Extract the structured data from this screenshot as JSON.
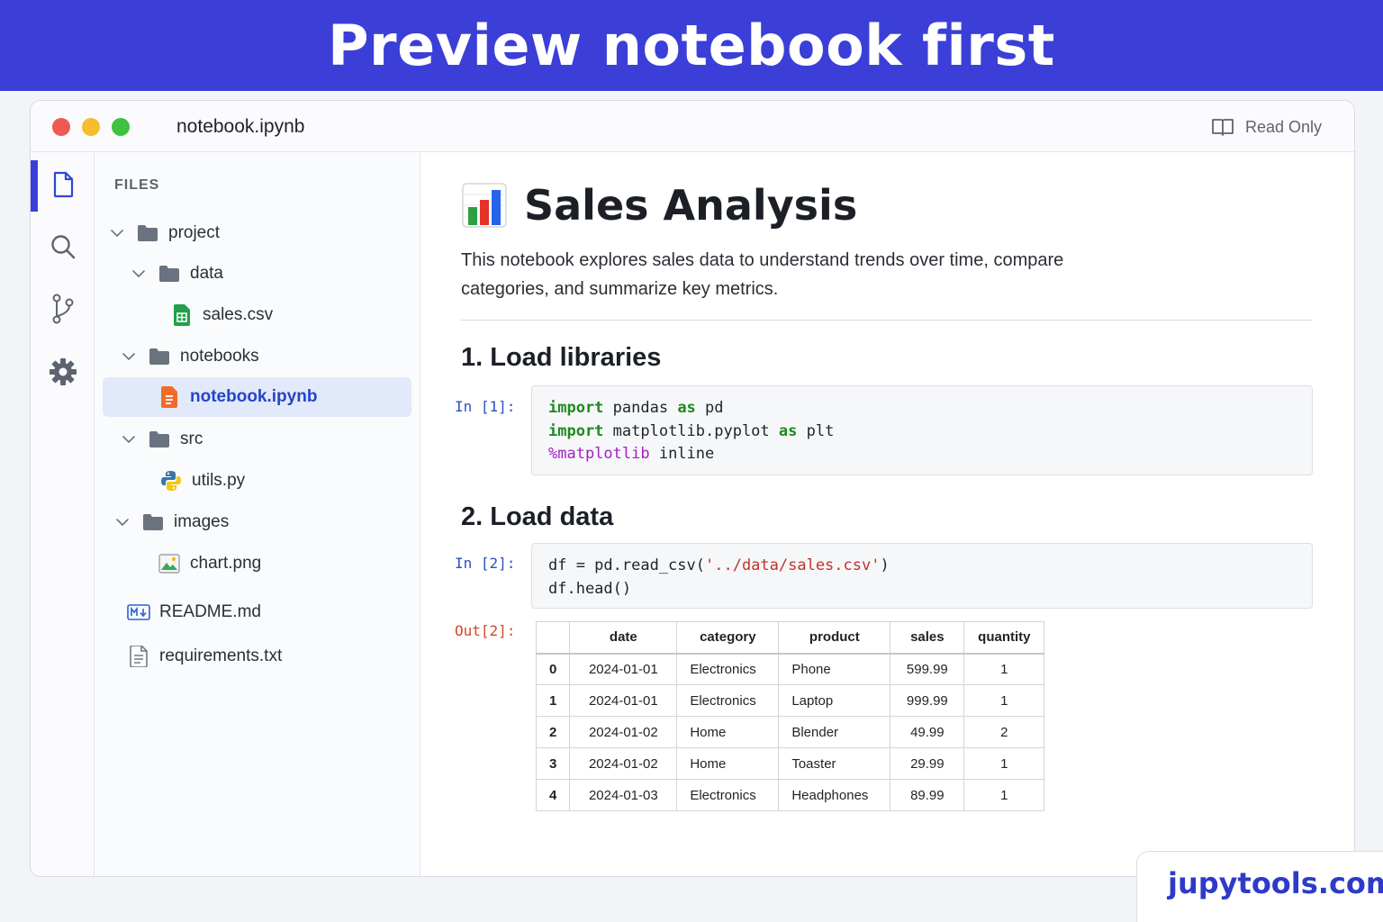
{
  "banner": {
    "title": "Preview notebook first"
  },
  "window": {
    "title": "notebook.ipynb",
    "mode_label": "Read Only"
  },
  "explorer": {
    "header": "FILES",
    "items": [
      {
        "label": "project",
        "type": "folder",
        "expanded": true
      },
      {
        "label": "data",
        "type": "folder",
        "expanded": true
      },
      {
        "label": "sales.csv",
        "type": "csv"
      },
      {
        "label": "notebooks",
        "type": "folder",
        "expanded": true
      },
      {
        "label": "notebook.ipynb",
        "type": "notebook",
        "selected": true
      },
      {
        "label": "src",
        "type": "folder",
        "expanded": true
      },
      {
        "label": "utils.py",
        "type": "python"
      },
      {
        "label": "images",
        "type": "folder",
        "expanded": true
      },
      {
        "label": "chart.png",
        "type": "image"
      },
      {
        "label": "README.md",
        "type": "markdown"
      },
      {
        "label": "requirements.txt",
        "type": "text"
      }
    ]
  },
  "notebook": {
    "title": "Sales Analysis",
    "description": "This notebook explores sales data to understand trends over time, compare categories, and summarize key metrics.",
    "sections": [
      {
        "heading": "1. Load libraries"
      },
      {
        "heading": "2. Load data"
      }
    ],
    "cells": [
      {
        "prompt": "In [1]:"
      },
      {
        "prompt": "In [2]:"
      }
    ],
    "output": {
      "prompt": "Out[2]:",
      "columns": [
        "",
        "date",
        "category",
        "product",
        "sales",
        "quantity"
      ],
      "rows": [
        [
          "0",
          "2024-01-01",
          "Electronics",
          "Phone",
          "599.99",
          "1"
        ],
        [
          "1",
          "2024-01-01",
          "Electronics",
          "Laptop",
          "999.99",
          "1"
        ],
        [
          "2",
          "2024-01-02",
          "Home",
          "Blender",
          "49.99",
          "2"
        ],
        [
          "3",
          "2024-01-02",
          "Home",
          "Toaster",
          "29.99",
          "1"
        ],
        [
          "4",
          "2024-01-03",
          "Electronics",
          "Headphones",
          "89.99",
          "1"
        ]
      ]
    }
  },
  "code": {
    "cell1": [
      [
        [
          "kw",
          "import"
        ],
        [
          "t",
          " pandas "
        ],
        [
          "kw",
          "as"
        ],
        [
          "t",
          " pd"
        ]
      ],
      [
        [
          "kw",
          "import"
        ],
        [
          "t",
          " matplotlib.pyplot "
        ],
        [
          "kw",
          "as"
        ],
        [
          "t",
          " plt"
        ]
      ],
      [
        [
          "mg",
          "%matplotlib"
        ],
        [
          "t",
          " inline"
        ]
      ]
    ],
    "cell2": [
      [
        [
          "t",
          "df = pd.read_csv("
        ],
        [
          "st",
          "'../data/sales.csv'"
        ],
        [
          "t",
          ")"
        ]
      ],
      [
        [
          "t",
          "df.head()"
        ]
      ]
    ]
  },
  "brand": {
    "text": "jupytools.com"
  },
  "colors": {
    "banner": "#3b3fd8",
    "accent": "#2445c7",
    "selected_bg": "#e2e9fb",
    "prompt_in": "#2b4fc4",
    "prompt_out": "#d8442b"
  }
}
